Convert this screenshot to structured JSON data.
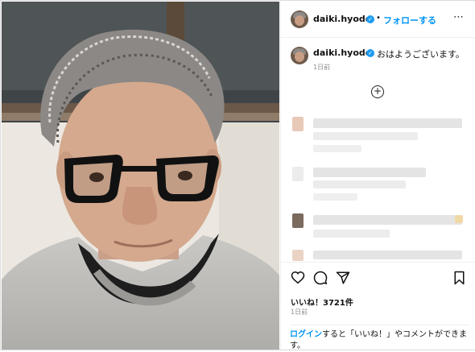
{
  "post": {
    "username": "daiki.hyodo",
    "follow_label": "フォローする",
    "caption": "おはようございます。",
    "caption_time": "1日前",
    "likes": "いいね！3721件",
    "post_time": "1日前",
    "login_link": "ログイン",
    "login_rest": "すると「いいね！」やコメントができます。"
  },
  "icons": [
    "verified-badge-icon",
    "more-options-icon",
    "add-comment-icon",
    "heart-icon",
    "comment-icon",
    "share-icon",
    "bookmark-icon"
  ]
}
